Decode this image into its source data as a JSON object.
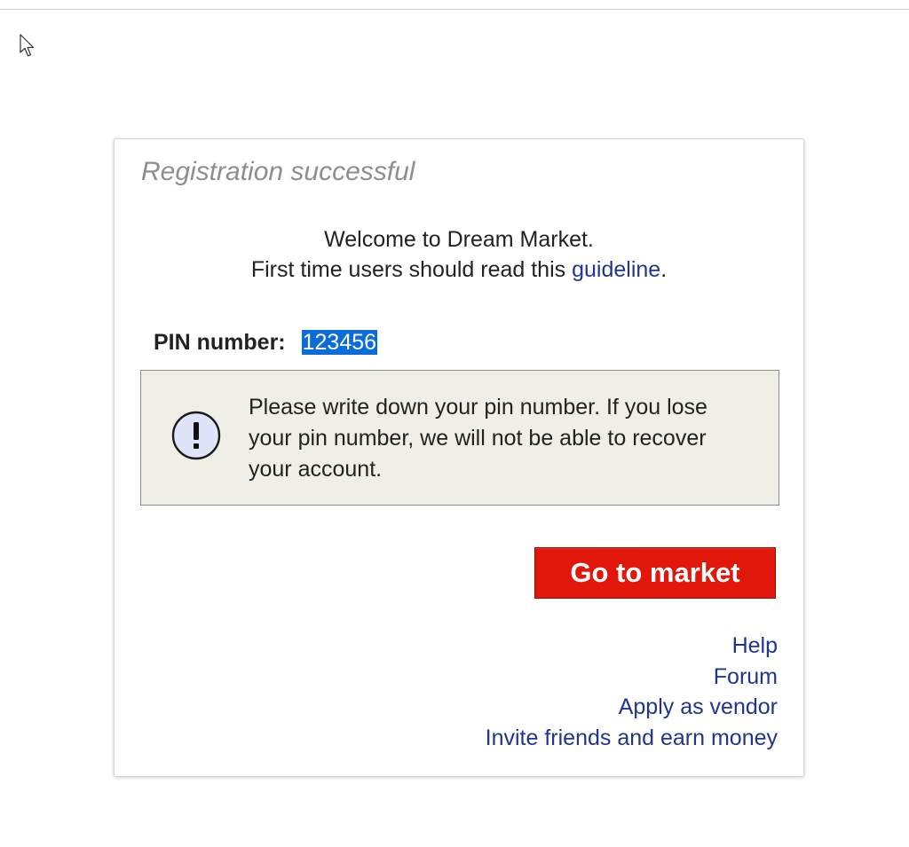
{
  "panel": {
    "title": "Registration successful",
    "welcome_line": "Welcome to Dream Market.",
    "guideline_prefix": "First time users should read this ",
    "guideline_link": "guideline",
    "guideline_suffix": "."
  },
  "pin": {
    "label": "PIN number:",
    "value": "123456"
  },
  "warning": {
    "icon": "exclamation-icon",
    "text": "Please write down your pin number. If you lose your pin number, we will not be able to recover your account."
  },
  "button": {
    "label": "Go to market",
    "color": "#e0170a"
  },
  "links": [
    {
      "label": "Help"
    },
    {
      "label": "Forum"
    },
    {
      "label": "Apply as vendor"
    },
    {
      "label": "Invite friends and earn money"
    }
  ],
  "colors": {
    "link": "#1f3591",
    "selection": "#0a6cd8",
    "warning_bg": "#f0efe7"
  }
}
